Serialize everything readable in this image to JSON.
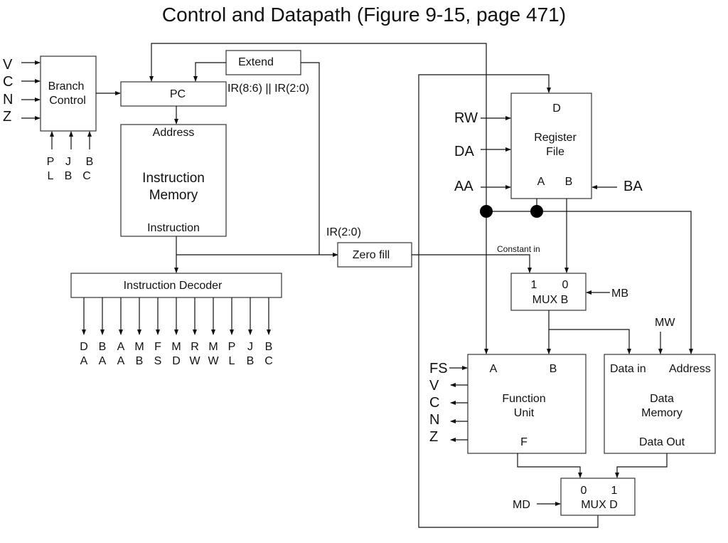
{
  "title": "Control and Datapath (Figure 9-15, page 471)",
  "branch_control": {
    "label_line1": "Branch",
    "label_line2": "Control",
    "status_inputs": [
      "V",
      "C",
      "N",
      "Z"
    ],
    "control_inputs": [
      {
        "top": "P",
        "bottom": "L"
      },
      {
        "top": "J",
        "bottom": "B"
      },
      {
        "top": "B",
        "bottom": "C"
      }
    ]
  },
  "pc": {
    "label": "PC"
  },
  "extend": {
    "label": "Extend",
    "input_label": "IR(8:6) || IR(2:0)"
  },
  "instruction_memory": {
    "address_label": "Address",
    "label_line1": "Instruction",
    "label_line2": "Memory",
    "output_label": "Instruction"
  },
  "instruction_decoder": {
    "label": "Instruction Decoder",
    "outputs": [
      {
        "top": "D",
        "bottom": "A"
      },
      {
        "top": "B",
        "bottom": "A"
      },
      {
        "top": "A",
        "bottom": "A"
      },
      {
        "top": "M",
        "bottom": "B"
      },
      {
        "top": "F",
        "bottom": "S"
      },
      {
        "top": "M",
        "bottom": "D"
      },
      {
        "top": "R",
        "bottom": "W"
      },
      {
        "top": "M",
        "bottom": "W"
      },
      {
        "top": "P",
        "bottom": "L"
      },
      {
        "top": "J",
        "bottom": "B"
      },
      {
        "top": "B",
        "bottom": "C"
      }
    ]
  },
  "zero_fill": {
    "label": "Zero fill",
    "input_label": "IR(2:0)",
    "output_label": "Constant in"
  },
  "register_file": {
    "label_line1": "Register",
    "label_line2": "File",
    "port_d": "D",
    "port_a": "A",
    "port_b": "B",
    "inputs": {
      "rw": "RW",
      "da": "DA",
      "aa": "AA",
      "ba": "BA"
    }
  },
  "mux_b": {
    "in1": "1",
    "in0": "0",
    "label": "MUX B",
    "select": "MB"
  },
  "function_unit": {
    "port_a": "A",
    "port_b": "B",
    "label_line1": "Function",
    "label_line2": "Unit",
    "port_f": "F",
    "select": "FS",
    "status_outputs": [
      "V",
      "C",
      "N",
      "Z"
    ]
  },
  "data_memory": {
    "data_in": "Data in",
    "address": "Address",
    "label_line1": "Data",
    "label_line2": "Memory",
    "data_out": "Data Out",
    "write": "MW"
  },
  "mux_d": {
    "in0": "0",
    "in1": "1",
    "label": "MUX D",
    "select": "MD"
  }
}
